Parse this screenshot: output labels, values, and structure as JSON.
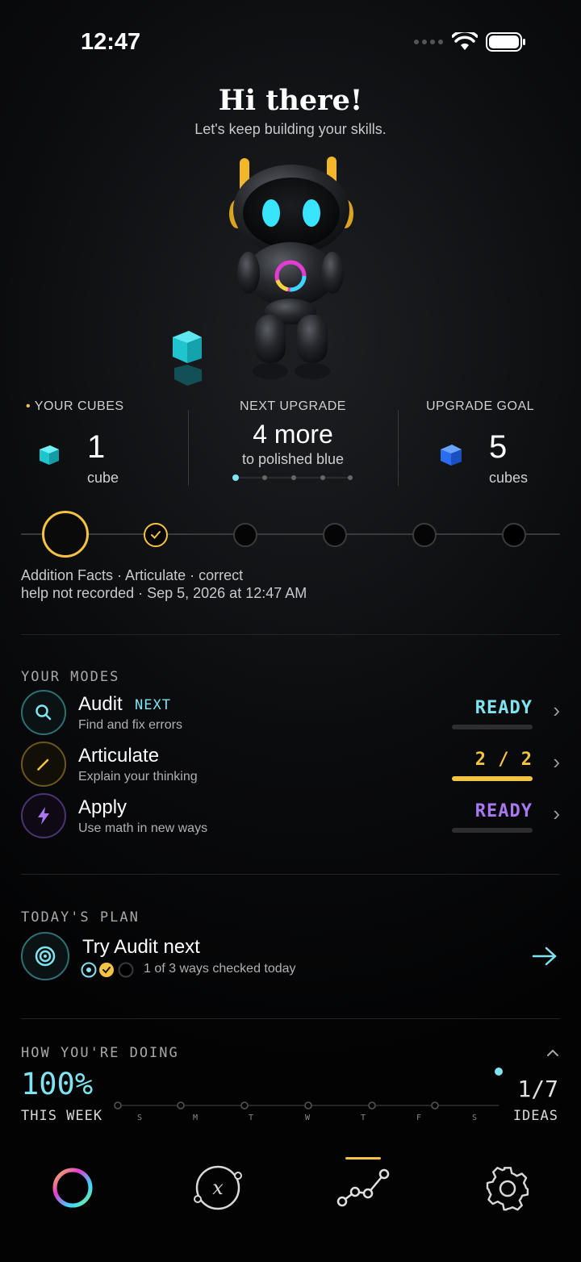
{
  "status_bar": {
    "time": "12:47"
  },
  "header": {
    "greeting": "Hi there!",
    "subtitle": "Let's keep building your skills."
  },
  "stats": {
    "cubes": {
      "label": "YOUR CUBES",
      "value": "1",
      "unit": "cube"
    },
    "next_upgrade": {
      "label": "NEXT UPGRADE",
      "value": "4 more",
      "detail": "to polished blue"
    },
    "goal": {
      "label": "UPGRADE GOAL",
      "value": "5",
      "unit": "cubes"
    }
  },
  "last_activity": {
    "line1": "Addition Facts · Articulate · correct",
    "line2": "help not recorded · Sep 5, 2026 at 12:47 AM"
  },
  "modes": {
    "title": "YOUR MODES",
    "items": [
      {
        "name": "Audit",
        "tag": "NEXT",
        "desc": "Find and fix errors",
        "status": "READY",
        "progress": 0,
        "color": "#7fe3f0"
      },
      {
        "name": "Articulate",
        "tag": "",
        "desc": "Explain your thinking",
        "status": "2 / 2",
        "progress": 1,
        "color": "#f5c343"
      },
      {
        "name": "Apply",
        "tag": "",
        "desc": "Use math in new ways",
        "status": "READY",
        "progress": 0,
        "color": "#a978f0"
      }
    ]
  },
  "plan": {
    "title": "TODAY'S PLAN",
    "headline": "Try Audit next",
    "detail": "1 of 3 ways checked today"
  },
  "progress": {
    "title": "HOW YOU'RE DOING",
    "percent": "100%",
    "period": "THIS WEEK",
    "days": [
      "S",
      "M",
      "T",
      "W",
      "T",
      "F",
      "S"
    ],
    "ideas_count": "1/7",
    "ideas_label": "IDEAS"
  },
  "colors": {
    "cyan": "#7fe3f0",
    "gold": "#f5c343",
    "purple": "#a978f0"
  },
  "nav": {
    "items": [
      "progress-ring-icon",
      "variable-x-icon",
      "graph-path-icon",
      "gear-icon"
    ],
    "active_index": 2
  }
}
